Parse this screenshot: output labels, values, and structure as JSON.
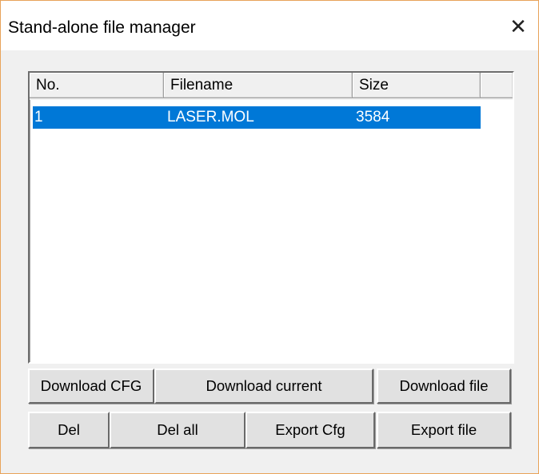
{
  "window": {
    "title": "Stand-alone file manager",
    "close_glyph": "✕"
  },
  "list": {
    "columns": [
      "No.",
      "Filename",
      "Size"
    ],
    "rows": [
      {
        "no": "1",
        "filename": "LASER.MOL",
        "size": "3584",
        "selected": true
      }
    ],
    "selection_color": "#0078d7"
  },
  "buttons": {
    "download_cfg": "Download CFG",
    "download_current": "Download current",
    "download_file": "Download file",
    "del": "Del",
    "del_all": "Del all",
    "export_cfg": "Export Cfg",
    "export_file": "Export file"
  }
}
